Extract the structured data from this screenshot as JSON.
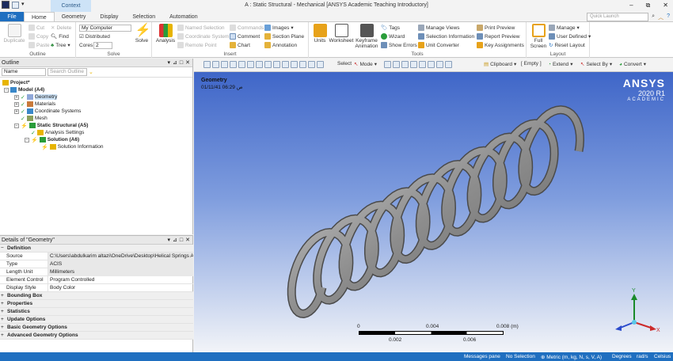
{
  "window": {
    "title": "A : Static Structural - Mechanical [ANSYS Academic Teaching Introductory]",
    "context_label": "Context",
    "controls": [
      "–",
      "⧉",
      "✕"
    ]
  },
  "tabs": {
    "file": "File",
    "items": [
      "Home",
      "Geometry",
      "Display",
      "Selection",
      "Automation"
    ],
    "active": "Home",
    "search_placeholder": "Quick Launch"
  },
  "ribbon": {
    "outline": {
      "label": "Outline",
      "duplicate": "Duplicate",
      "cut": "Cut",
      "copy": "Copy",
      "paste": "Paste",
      "delete": "Delete",
      "find": "Find",
      "tree": "Tree"
    },
    "solve": {
      "label": "Solve",
      "computer": "My Computer",
      "distributed": "Distributed",
      "cores_label": "Cores",
      "cores_value": "2",
      "solve_button": "Solve"
    },
    "insert": {
      "label": "Insert",
      "analysis": "Analysis",
      "named_selection": "Named Selection",
      "coordinate_system": "Coordinate System",
      "remote_point": "Remote Point",
      "commands": "Commands",
      "comment": "Comment",
      "chart": "Chart",
      "images": "Images",
      "section_plane": "Section Plane",
      "annotation": "Annotation"
    },
    "tools": {
      "label": "Tools",
      "units": "Units",
      "worksheet": "Worksheet",
      "keyframe_animation": "Keyframe Animation",
      "tags": "Tags",
      "wizard": "Wizard",
      "show_errors": "Show Errors",
      "manage_views": "Manage Views",
      "selection_information": "Selection Information",
      "unit_converter": "Unit Converter",
      "print_preview": "Print Preview",
      "report_preview": "Report Preview",
      "key_assignments": "Key Assignments"
    },
    "layout": {
      "label": "Layout",
      "full_screen": "Full Screen",
      "manage": "Manage",
      "user_defined": "User Defined",
      "reset_layout": "Reset Layout"
    }
  },
  "outline_panel": {
    "title": "Outline",
    "filter_name": "Name",
    "search_placeholder": "Search Outline",
    "tree": [
      {
        "label": "Project*",
        "level": 0,
        "bold": true
      },
      {
        "label": "Model (A4)",
        "level": 1,
        "bold": true
      },
      {
        "label": "Geometry",
        "level": 2,
        "bold": false
      },
      {
        "label": "Materials",
        "level": 2,
        "bold": false
      },
      {
        "label": "Coordinate Systems",
        "level": 2,
        "bold": false
      },
      {
        "label": "Mesh",
        "level": 2,
        "bold": false
      },
      {
        "label": "Static Structural (A5)",
        "level": 2,
        "bold": true
      },
      {
        "label": "Analysis Settings",
        "level": 3,
        "bold": false
      },
      {
        "label": "Solution (A6)",
        "level": 3,
        "bold": true
      },
      {
        "label": "Solution Information",
        "level": 4,
        "bold": false
      }
    ]
  },
  "details_panel": {
    "title": "Details of \"Geometry\"",
    "definition": "Definition",
    "rows": [
      {
        "key": "Source",
        "value": "C:\\Users\\abdulkarim altazi\\OneDrive\\Desktop\\Helical Springs A..."
      },
      {
        "key": "Type",
        "value": "ACIS"
      },
      {
        "key": "Length Unit",
        "value": "Millimeters"
      },
      {
        "key": "Element Control",
        "value": "Program Controlled"
      },
      {
        "key": "Display Style",
        "value": "Body Color"
      }
    ],
    "sections": [
      "Bounding Box",
      "Properties",
      "Statistics",
      "Update Options",
      "Basic Geometry Options",
      "Advanced Geometry Options"
    ]
  },
  "viewport_toolbar": {
    "select": "Select",
    "mode": "Mode",
    "clipboard": "Clipboard",
    "empty": "[ Empty ]",
    "extend": "Extend",
    "select_by": "Select By",
    "convert": "Convert"
  },
  "viewport": {
    "title": "Geometry",
    "date": "01/11/41 06:29 ص",
    "brand": "ANSYS",
    "version": "2020 R1",
    "edition": "ACADEMIC",
    "scale_top": [
      "0",
      "0.004",
      "0.008 (m)"
    ],
    "scale_bottom": [
      "0.002",
      "0.006"
    ],
    "axes": {
      "y": "Y",
      "z": "Z",
      "x": "X"
    }
  },
  "status_bar": {
    "messages": "Messages pane",
    "selection": "No Selection",
    "units": "Metric (m, kg, N, s, V, A)",
    "angle": "Degrees",
    "rate": "rad/s",
    "temp": "Celsius"
  }
}
